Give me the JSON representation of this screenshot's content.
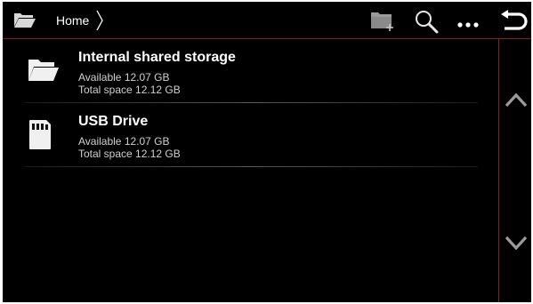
{
  "topbar": {
    "breadcrumb": "Home",
    "icons": [
      "folder-open-icon",
      "new-folder-icon",
      "search-icon",
      "more-icon",
      "back-icon"
    ]
  },
  "storage": [
    {
      "name": "Internal shared storage",
      "available": "Available 12.07 GB",
      "total": "Total space 12.12 GB",
      "icon": "folder-icon"
    },
    {
      "name": "USB Drive",
      "available": "Available 12.07 GB",
      "total": "Total space 12.12 GB",
      "icon": "sd-card-icon"
    }
  ],
  "scroll": {
    "up_icon": "chevron-up-icon",
    "down_icon": "chevron-down-icon"
  },
  "colors": {
    "background": "#000000",
    "accent": "#8f1a1a",
    "text": "#ffffff",
    "subtext": "#d0d0d0"
  }
}
